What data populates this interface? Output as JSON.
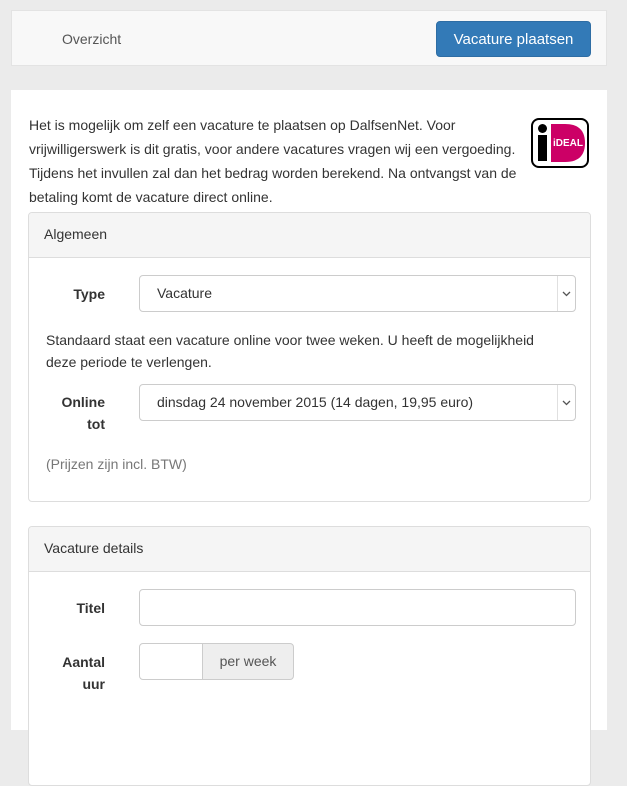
{
  "nav": {
    "overview_label": "Overzicht",
    "post_button_label": "Vacature plaatsen"
  },
  "intro": {
    "text": "Het is mogelijk om zelf een vacature te plaatsen op DalfsenNet. Voor vrijwilligerswerk is dit gratis, voor andere vacatures vragen wij een vergoeding. Tijdens het invullen zal dan het bedrag worden berekend. Na ontvangst van de betaling komt de vacature direct online.",
    "logo_icon": "ideal-logo",
    "logo_text": "iDEAL",
    "logo_color": "#cc0066"
  },
  "general": {
    "heading": "Algemeen",
    "type_label": "Type",
    "type_value": "Vacature",
    "info_text": "Standaard staat een vacature online voor twee weken. U heeft de mogelijkheid deze periode te verlengen.",
    "online_label_1": "Online",
    "online_label_2": "tot",
    "online_value": "dinsdag 24 november 2015 (14 dagen, 19,95 euro)",
    "price_note": "(Prijzen zijn incl. BTW)"
  },
  "details": {
    "heading": "Vacature details",
    "title_label": "Titel",
    "title_value": "",
    "hours_label_1": "Aantal",
    "hours_label_2": "uur",
    "hours_value": "",
    "hours_addon": "per week"
  },
  "colors": {
    "primary": "#337ab7",
    "panel_heading_bg": "#f5f5f5",
    "page_bg": "#ebebeb"
  }
}
